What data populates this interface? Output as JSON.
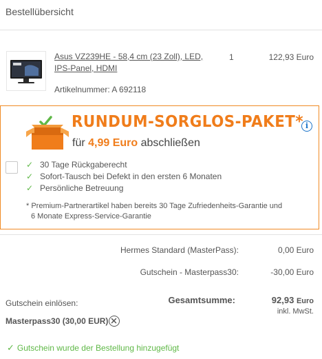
{
  "header": {
    "title": "Bestellübersicht"
  },
  "product": {
    "name": "Asus VZ239HE - 58,4 cm (23 Zoll), LED, IPS-Panel, HDMI",
    "article": "Artikelnummer: A 692118",
    "quantity": "1",
    "price": "122,93 Euro"
  },
  "promo": {
    "title": "RUNDUM-SORGLOS-PAKET*",
    "sub_prefix": "für ",
    "sub_price": "4,99 Euro",
    "sub_suffix": " abschließen",
    "info_icon": "i",
    "features": [
      "30 Tage Rückgaberecht",
      "Sofort-Tausch bei Defekt in den ersten 6 Monaten",
      "Persönliche Betreuung"
    ],
    "note_line1": "* Premium-Partnerartikel haben bereits 30 Tage Zufriedenheits-Garantie und",
    "note_line2": "6 Monate Express-Service-Garantie",
    "accent": "#f07d1b"
  },
  "summary": {
    "shipping_label": "Hermes Standard (MasterPass):",
    "shipping_value": "0,00 Euro",
    "voucher_label": "Gutschein - Masterpass30:",
    "voucher_value": "-30,00 Euro",
    "total_label": "Gesamtsumme:",
    "total_amount": "92,93",
    "total_unit": "Euro",
    "vat": "inkl. MwSt."
  },
  "coupon": {
    "label": "Gutschein einlösen:",
    "code": "Masterpass30 (30,00 EUR)",
    "success": "Gutschein wurde der Bestellung hinzugefügt",
    "success_color": "#5fb847"
  }
}
